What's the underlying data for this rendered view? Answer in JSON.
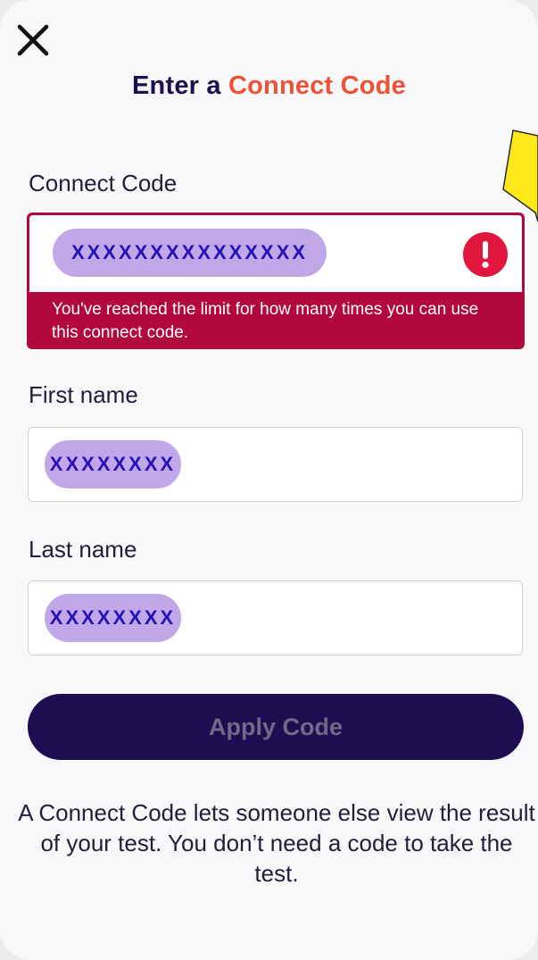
{
  "header": {
    "close_icon": "close-x-icon",
    "title_part1": "Enter a ",
    "title_part2": "Connect Code"
  },
  "connect_code": {
    "label": "Connect Code",
    "value": "XXXXXXXXXXXXXXX",
    "error_icon": "exclamation-icon",
    "error_message": "You've reached the limit for how many times you can use this connect code."
  },
  "first_name": {
    "label": "First name",
    "value": "XXXXXXXX"
  },
  "last_name": {
    "label": "Last name",
    "value": "XXXXXXXX"
  },
  "apply_button": {
    "label": "Apply Code"
  },
  "footer": {
    "text": "A Connect Code lets someone else view the result of your test. You don’t need a code to take the test."
  },
  "colors": {
    "brand_navy": "#1f0d52",
    "accent_orange": "#ee5236",
    "error_red": "#b3083c",
    "redaction_purple": "#c0a8e8",
    "callout_yellow": "#ffe81a"
  }
}
